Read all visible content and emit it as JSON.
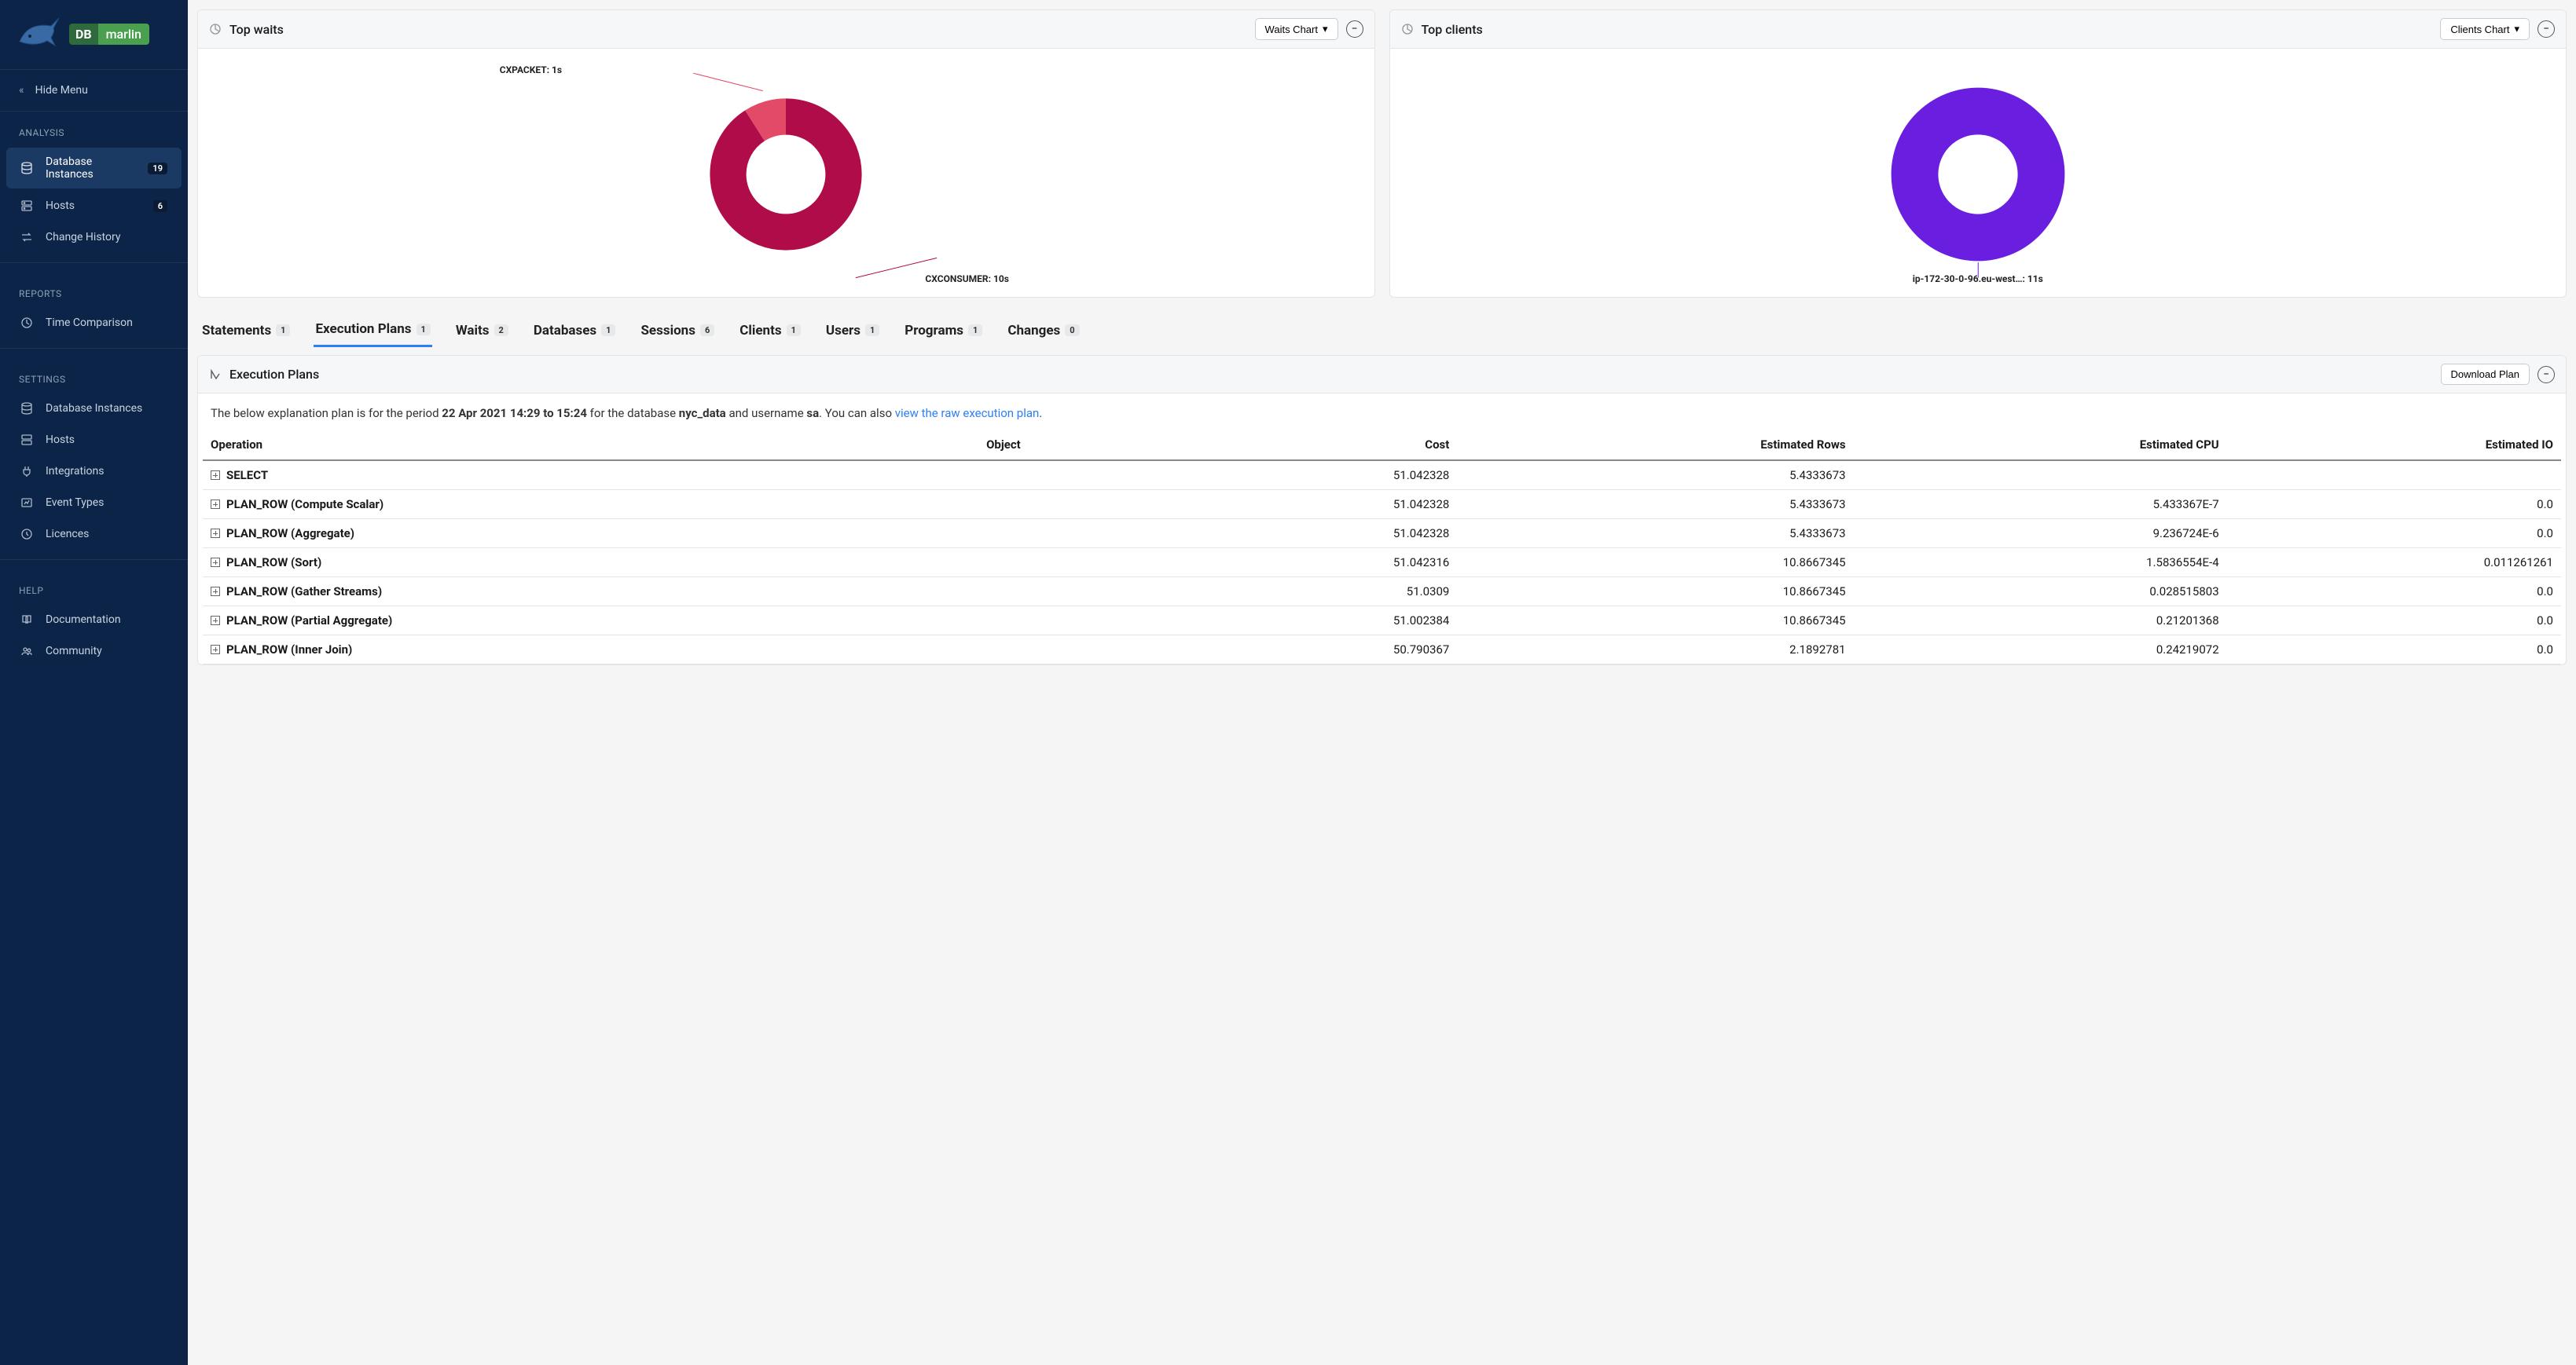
{
  "brand": {
    "db": "DB",
    "marlin": "marlin"
  },
  "sidebar": {
    "hide_menu": "Hide Menu",
    "sections": {
      "analysis": "ANALYSIS",
      "reports": "REPORTS",
      "settings": "SETTINGS",
      "help": "HELP"
    },
    "analysis": [
      {
        "label": "Database Instances",
        "badge": "19"
      },
      {
        "label": "Hosts",
        "badge": "6"
      },
      {
        "label": "Change History",
        "badge": ""
      }
    ],
    "reports": [
      {
        "label": "Time Comparison"
      }
    ],
    "settings": [
      {
        "label": "Database Instances"
      },
      {
        "label": "Hosts"
      },
      {
        "label": "Integrations"
      },
      {
        "label": "Event Types"
      },
      {
        "label": "Licences"
      }
    ],
    "help": [
      {
        "label": "Documentation"
      },
      {
        "label": "Community"
      }
    ]
  },
  "charts": {
    "waits": {
      "title": "Top waits",
      "button": "Waits Chart",
      "label_a": "CXPACKET: 1s",
      "label_b": "CXCONSUMER: 10s"
    },
    "clients": {
      "title": "Top clients",
      "button": "Clients Chart",
      "label_a": "ip-172-30-0-96.eu-west…: 11s"
    }
  },
  "chart_data": [
    {
      "type": "pie",
      "title": "Top waits",
      "categories": [
        "CXPACKET",
        "CXCONSUMER"
      ],
      "values": [
        1,
        10
      ],
      "unit": "s",
      "colors": [
        "#e24a68",
        "#b00c4a"
      ]
    },
    {
      "type": "pie",
      "title": "Top clients",
      "categories": [
        "ip-172-30-0-96.eu-west…"
      ],
      "values": [
        11
      ],
      "unit": "s",
      "colors": [
        "#6a1fe0"
      ]
    }
  ],
  "tabs": [
    {
      "label": "Statements",
      "badge": "1"
    },
    {
      "label": "Execution Plans",
      "badge": "1"
    },
    {
      "label": "Waits",
      "badge": "2"
    },
    {
      "label": "Databases",
      "badge": "1"
    },
    {
      "label": "Sessions",
      "badge": "6"
    },
    {
      "label": "Clients",
      "badge": "1"
    },
    {
      "label": "Users",
      "badge": "1"
    },
    {
      "label": "Programs",
      "badge": "1"
    },
    {
      "label": "Changes",
      "badge": "0"
    }
  ],
  "active_tab": 1,
  "panel": {
    "title": "Execution Plans",
    "download": "Download Plan",
    "desc_prefix": "The below explanation plan is for the period ",
    "desc_period": "22 Apr 2021 14:29 to 15:24",
    "desc_mid1": " for the database ",
    "desc_db": "nyc_data",
    "desc_mid2": " and username ",
    "desc_user": "sa",
    "desc_mid3": ". You can also ",
    "desc_link": "view the raw execution plan",
    "desc_suffix": "."
  },
  "plan": {
    "columns": [
      "Operation",
      "Object",
      "Cost",
      "Estimated Rows",
      "Estimated CPU",
      "Estimated IO"
    ],
    "rows": [
      {
        "op": "SELECT",
        "object": "",
        "cost": "51.042328",
        "rows": "5.4333673",
        "cpu": "",
        "io": ""
      },
      {
        "op": "PLAN_ROW (Compute Scalar)",
        "object": "",
        "cost": "51.042328",
        "rows": "5.4333673",
        "cpu": "5.433367E-7",
        "io": "0.0"
      },
      {
        "op": "PLAN_ROW (Aggregate)",
        "object": "",
        "cost": "51.042328",
        "rows": "5.4333673",
        "cpu": "9.236724E-6",
        "io": "0.0"
      },
      {
        "op": "PLAN_ROW (Sort)",
        "object": "",
        "cost": "51.042316",
        "rows": "10.8667345",
        "cpu": "1.5836554E-4",
        "io": "0.011261261"
      },
      {
        "op": "PLAN_ROW (Gather Streams)",
        "object": "",
        "cost": "51.0309",
        "rows": "10.8667345",
        "cpu": "0.028515803",
        "io": "0.0"
      },
      {
        "op": "PLAN_ROW (Partial Aggregate)",
        "object": "",
        "cost": "51.002384",
        "rows": "10.8667345",
        "cpu": "0.21201368",
        "io": "0.0"
      },
      {
        "op": "PLAN_ROW (Inner Join)",
        "object": "",
        "cost": "50.790367",
        "rows": "2.1892781",
        "cpu": "0.24219072",
        "io": "0.0"
      }
    ]
  }
}
